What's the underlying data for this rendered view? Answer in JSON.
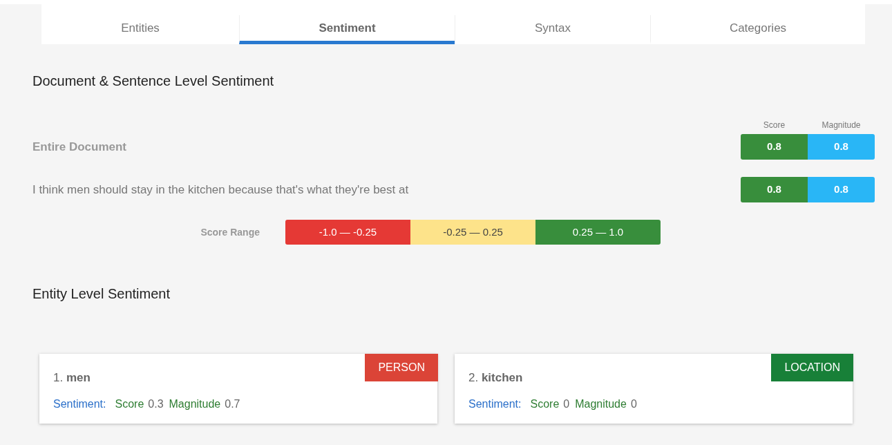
{
  "tabs": [
    {
      "label": "Entities",
      "selected": false
    },
    {
      "label": "Sentiment",
      "selected": true
    },
    {
      "label": "Syntax",
      "selected": false
    },
    {
      "label": "Categories",
      "selected": false
    }
  ],
  "document_section": {
    "title": "Document & Sentence Level Sentiment",
    "columns": [
      "Score",
      "Magnitude"
    ],
    "rows": [
      {
        "kind": "document",
        "text": "Entire Document",
        "score": "0.8",
        "magnitude": "0.8"
      },
      {
        "kind": "sentence",
        "text": "I think men should stay in the kitchen because that's what they're best at",
        "score": "0.8",
        "magnitude": "0.8"
      }
    ]
  },
  "score_range": {
    "label": "Score Range",
    "segments": [
      {
        "label": "-1.0 — -0.25",
        "color": "#e53935"
      },
      {
        "label": "-0.25 — 0.25",
        "color": "#fde38a"
      },
      {
        "label": "0.25 — 1.0",
        "color": "#388e3c"
      }
    ]
  },
  "entity_section": {
    "title": "Entity Level Sentiment",
    "entities": [
      {
        "title": "1. **men**",
        "type": "PERSON",
        "color": "#db4437",
        "sentiment_label": "Sentiment:",
        "score_label": "Score",
        "score": "0.3",
        "magnitude_label": "Magnitude",
        "magnitude": "0.7"
      },
      {
        "title": "2. **kitchen**",
        "type": "LOCATION",
        "color": "#188038",
        "sentiment_label": "Sentiment:",
        "score_label": "Score",
        "score": "0",
        "magnitude_label": "Magnitude",
        "magnitude": "0"
      }
    ]
  }
}
